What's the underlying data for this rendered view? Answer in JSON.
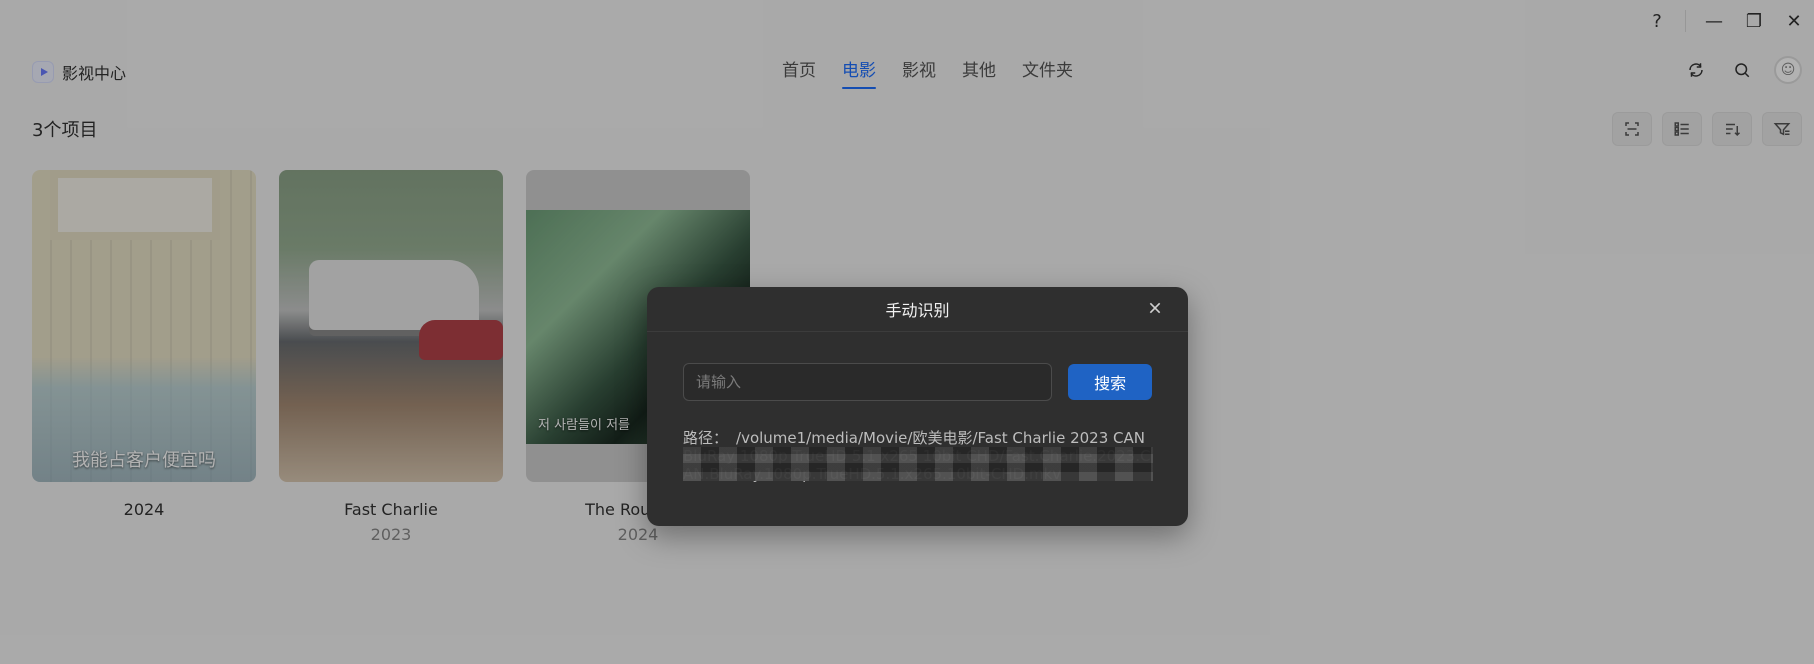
{
  "window": {
    "help_label": "?",
    "minimize_label": "—",
    "restore_label": "❐",
    "close_label": "✕"
  },
  "app": {
    "name": "影视中心",
    "accent": "#1e6fff"
  },
  "nav": {
    "items": [
      "首页",
      "电影",
      "影视",
      "其他",
      "文件夹"
    ],
    "active": "电影"
  },
  "content": {
    "count_label": "3个项目"
  },
  "cards": [
    {
      "title": "2024",
      "year": "",
      "poster_caption": "我能占客户便宜吗"
    },
    {
      "title": "Fast Charlie",
      "year": "2023",
      "poster_caption": ""
    },
    {
      "title": "The Roundup",
      "year": "2024",
      "poster_caption": "저 사람들이 저를"
    }
  ],
  "modal": {
    "title": "手动识别",
    "input_placeholder": "请输入",
    "input_value": "",
    "search_label": "搜索",
    "path_label": "路径：",
    "path_value": "/volume1/media/Movie/欧美电影/Fast Charlie 2023 CAN BluRay 1080p TrueHD 5.1 x265 10bit CHD/Fast.Charlie.2023.CAN.BluRay.1080p.TrueHD.5.1.x265.10bit-CHD.mkv",
    "primary_color": "#1f63c4"
  }
}
